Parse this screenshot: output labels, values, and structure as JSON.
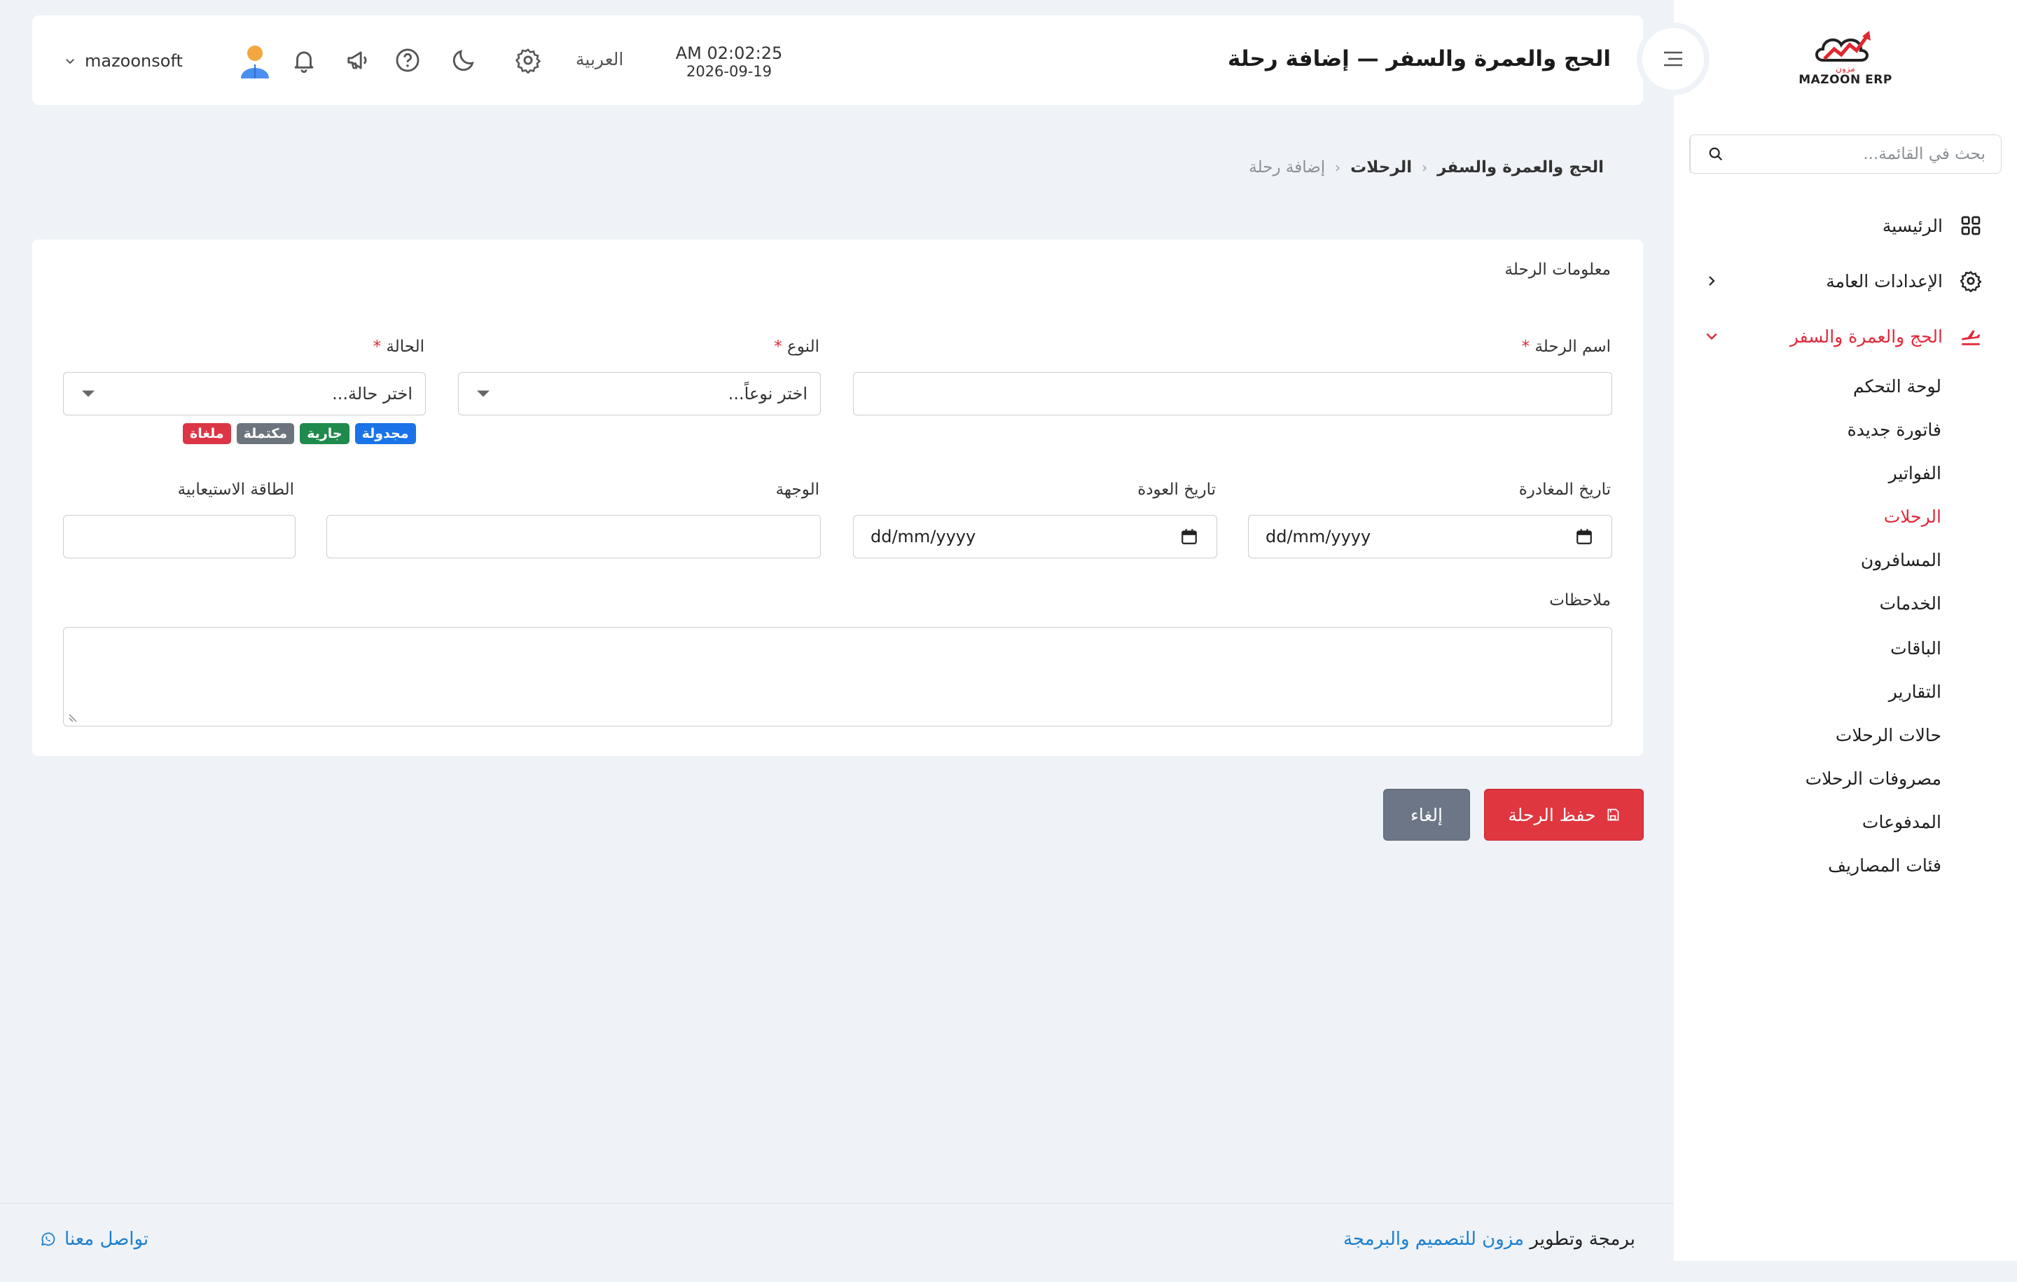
{
  "brand": {
    "logo_text": "MAZOON ERP",
    "logo_subtext": "مزون"
  },
  "sidebar": {
    "search_placeholder": "بحث في القائمة...",
    "items": [
      {
        "label": "الرئيسية",
        "icon": "grid-icon"
      },
      {
        "label": "الإعدادات العامة",
        "icon": "gear-icon"
      },
      {
        "label": "الحج والعمرة والسفر",
        "icon": "plane-icon"
      }
    ],
    "subitems": [
      "لوحة التحكم",
      "فاتورة جديدة",
      "الفواتير",
      "الرحلات",
      "المسافرون",
      "الخدمات",
      "الباقات",
      "التقارير",
      "حالات الرحلات",
      "مصروفات الرحلات",
      "المدفوعات",
      "فئات المصاريف"
    ]
  },
  "header": {
    "title": "الحج والعمرة والسفر — إضافة رحلة",
    "time": "AM 02:02:25",
    "date": "2026-09-19",
    "language": "العربية",
    "username": "mazoonsoft"
  },
  "breadcrumb": {
    "level1": "الحج والعمرة والسفر",
    "level2": "الرحلات",
    "current": "إضافة رحلة"
  },
  "form": {
    "section_title": "معلومات الرحلة",
    "trip_name_label": "اسم الرحلة",
    "trip_name_value": "",
    "type_label": "النوع",
    "type_placeholder": "اختر نوعاً...",
    "status_label": "الحالة",
    "status_placeholder": "اختر حالة...",
    "required_mark": "*",
    "status_badges": [
      {
        "label": "مجدولة",
        "color": "#1a73e8"
      },
      {
        "label": "جارية",
        "color": "#1e8a4c"
      },
      {
        "label": "مكتملة",
        "color": "#6c757d"
      },
      {
        "label": "ملغاة",
        "color": "#dc3545"
      }
    ],
    "departure_label": "تاريخ المغادرة",
    "return_label": "تاريخ العودة",
    "date_placeholder": "dd/mm/yyyy",
    "destination_label": "الوجهة",
    "capacity_label": "الطاقة الاستيعابية",
    "notes_label": "ملاحظات"
  },
  "actions": {
    "save_label": "حفظ الرحلة",
    "cancel_label": "إلغاء"
  },
  "footer": {
    "credit_prefix": "برمجة وتطوير",
    "credit_brand": "مزون للتصميم والبرمجة",
    "contact": "تواصل معنا"
  },
  "colors": {
    "accent": "#e02a3a",
    "link": "#1b7fcf",
    "background": "#eff3f7"
  }
}
